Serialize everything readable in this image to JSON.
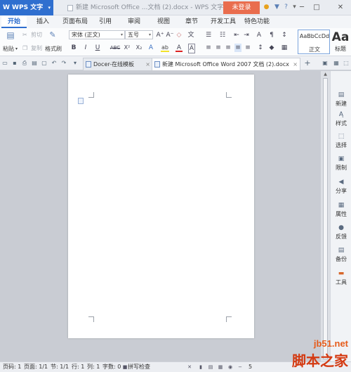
{
  "title_bar": {
    "app_name": "W WPS 文字",
    "app_arrow": "▾",
    "doc_title": "新建 Microsoft Office ...文档 (2).docx - WPS 文字",
    "login": "未登录",
    "icons": [
      "skin-icon",
      "shirt-icon",
      "help-icon",
      "menu-icon"
    ],
    "help_glyph": "?",
    "minimize": "─",
    "maximize": "□",
    "close": "✕"
  },
  "menu": {
    "tabs": [
      "开始",
      "插入",
      "页面布局",
      "引用",
      "审阅",
      "视图",
      "章节",
      "开发工具",
      "特色功能"
    ],
    "active": "开始"
  },
  "ribbon": {
    "paste": "粘贴",
    "cut": "剪切",
    "copy": "复制",
    "format_painter": "格式刷",
    "font_name": "宋体 (正文)",
    "font_size": "五号",
    "grow_font": "A⁺",
    "shrink_font": "A⁻",
    "clear_format": "◇",
    "pinyin": "文",
    "bold": "B",
    "italic": "I",
    "underline": "U",
    "strike": "ABC",
    "superscript": "X²",
    "subscript": "X₂",
    "text_effect": "A",
    "highlight": "ab",
    "font_color": "A",
    "char_border": "A",
    "style_sample": "AaBbCcDd",
    "style_name": "正文",
    "style_big": "Aa",
    "style_big_name": "标题"
  },
  "tab_bar": {
    "tabs": [
      {
        "label": "Docer-在线模板",
        "active": false
      },
      {
        "label": "新建 Microsoft Office Word 2007 文档 (2).docx",
        "active": true
      }
    ],
    "close_glyph": "×",
    "add_glyph": "+"
  },
  "sidebar": {
    "items": [
      {
        "label": "新建",
        "icon": "new-icon",
        "glyph": "▤"
      },
      {
        "label": "样式",
        "icon": "style-icon",
        "glyph": "Ą"
      },
      {
        "label": "选择",
        "icon": "select-icon",
        "glyph": "⬚"
      },
      {
        "label": "限制",
        "icon": "restrict-icon",
        "glyph": "▣"
      },
      {
        "label": "分享",
        "icon": "share-icon",
        "glyph": "◀"
      },
      {
        "label": "属性",
        "icon": "property-icon",
        "glyph": "▦"
      },
      {
        "label": "反馈",
        "icon": "feedback-icon",
        "glyph": "●"
      },
      {
        "label": "备份",
        "icon": "backup-icon",
        "glyph": "▤"
      },
      {
        "label": "工具",
        "icon": "toolbox-icon",
        "glyph": "▬"
      }
    ]
  },
  "status_bar": {
    "page_num": "页码: 1",
    "pages": "页面: 1/1",
    "section": "节: 1/1",
    "row": "行: 1",
    "col": "列: 1",
    "words": "字数: 0",
    "spell_check": "拼写检查",
    "zoom": "5"
  },
  "watermark": {
    "site": "jb51.net",
    "name": "脚本之家"
  },
  "colors": {
    "accent": "#2f6fcf",
    "login": "#e96d4e",
    "watermark": "#d43a12"
  }
}
